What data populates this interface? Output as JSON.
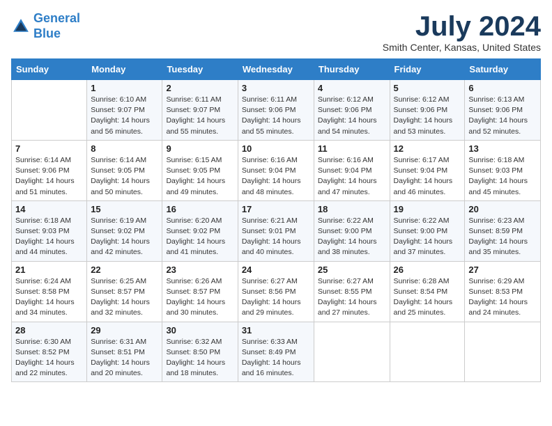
{
  "header": {
    "logo_line1": "General",
    "logo_line2": "Blue",
    "month": "July 2024",
    "location": "Smith Center, Kansas, United States"
  },
  "days_of_week": [
    "Sunday",
    "Monday",
    "Tuesday",
    "Wednesday",
    "Thursday",
    "Friday",
    "Saturday"
  ],
  "weeks": [
    [
      {
        "day": "",
        "sunrise": "",
        "sunset": "",
        "daylight": ""
      },
      {
        "day": "1",
        "sunrise": "Sunrise: 6:10 AM",
        "sunset": "Sunset: 9:07 PM",
        "daylight": "Daylight: 14 hours and 56 minutes."
      },
      {
        "day": "2",
        "sunrise": "Sunrise: 6:11 AM",
        "sunset": "Sunset: 9:07 PM",
        "daylight": "Daylight: 14 hours and 55 minutes."
      },
      {
        "day": "3",
        "sunrise": "Sunrise: 6:11 AM",
        "sunset": "Sunset: 9:06 PM",
        "daylight": "Daylight: 14 hours and 55 minutes."
      },
      {
        "day": "4",
        "sunrise": "Sunrise: 6:12 AM",
        "sunset": "Sunset: 9:06 PM",
        "daylight": "Daylight: 14 hours and 54 minutes."
      },
      {
        "day": "5",
        "sunrise": "Sunrise: 6:12 AM",
        "sunset": "Sunset: 9:06 PM",
        "daylight": "Daylight: 14 hours and 53 minutes."
      },
      {
        "day": "6",
        "sunrise": "Sunrise: 6:13 AM",
        "sunset": "Sunset: 9:06 PM",
        "daylight": "Daylight: 14 hours and 52 minutes."
      }
    ],
    [
      {
        "day": "7",
        "sunrise": "Sunrise: 6:14 AM",
        "sunset": "Sunset: 9:06 PM",
        "daylight": "Daylight: 14 hours and 51 minutes."
      },
      {
        "day": "8",
        "sunrise": "Sunrise: 6:14 AM",
        "sunset": "Sunset: 9:05 PM",
        "daylight": "Daylight: 14 hours and 50 minutes."
      },
      {
        "day": "9",
        "sunrise": "Sunrise: 6:15 AM",
        "sunset": "Sunset: 9:05 PM",
        "daylight": "Daylight: 14 hours and 49 minutes."
      },
      {
        "day": "10",
        "sunrise": "Sunrise: 6:16 AM",
        "sunset": "Sunset: 9:04 PM",
        "daylight": "Daylight: 14 hours and 48 minutes."
      },
      {
        "day": "11",
        "sunrise": "Sunrise: 6:16 AM",
        "sunset": "Sunset: 9:04 PM",
        "daylight": "Daylight: 14 hours and 47 minutes."
      },
      {
        "day": "12",
        "sunrise": "Sunrise: 6:17 AM",
        "sunset": "Sunset: 9:04 PM",
        "daylight": "Daylight: 14 hours and 46 minutes."
      },
      {
        "day": "13",
        "sunrise": "Sunrise: 6:18 AM",
        "sunset": "Sunset: 9:03 PM",
        "daylight": "Daylight: 14 hours and 45 minutes."
      }
    ],
    [
      {
        "day": "14",
        "sunrise": "Sunrise: 6:18 AM",
        "sunset": "Sunset: 9:03 PM",
        "daylight": "Daylight: 14 hours and 44 minutes."
      },
      {
        "day": "15",
        "sunrise": "Sunrise: 6:19 AM",
        "sunset": "Sunset: 9:02 PM",
        "daylight": "Daylight: 14 hours and 42 minutes."
      },
      {
        "day": "16",
        "sunrise": "Sunrise: 6:20 AM",
        "sunset": "Sunset: 9:02 PM",
        "daylight": "Daylight: 14 hours and 41 minutes."
      },
      {
        "day": "17",
        "sunrise": "Sunrise: 6:21 AM",
        "sunset": "Sunset: 9:01 PM",
        "daylight": "Daylight: 14 hours and 40 minutes."
      },
      {
        "day": "18",
        "sunrise": "Sunrise: 6:22 AM",
        "sunset": "Sunset: 9:00 PM",
        "daylight": "Daylight: 14 hours and 38 minutes."
      },
      {
        "day": "19",
        "sunrise": "Sunrise: 6:22 AM",
        "sunset": "Sunset: 9:00 PM",
        "daylight": "Daylight: 14 hours and 37 minutes."
      },
      {
        "day": "20",
        "sunrise": "Sunrise: 6:23 AM",
        "sunset": "Sunset: 8:59 PM",
        "daylight": "Daylight: 14 hours and 35 minutes."
      }
    ],
    [
      {
        "day": "21",
        "sunrise": "Sunrise: 6:24 AM",
        "sunset": "Sunset: 8:58 PM",
        "daylight": "Daylight: 14 hours and 34 minutes."
      },
      {
        "day": "22",
        "sunrise": "Sunrise: 6:25 AM",
        "sunset": "Sunset: 8:57 PM",
        "daylight": "Daylight: 14 hours and 32 minutes."
      },
      {
        "day": "23",
        "sunrise": "Sunrise: 6:26 AM",
        "sunset": "Sunset: 8:57 PM",
        "daylight": "Daylight: 14 hours and 30 minutes."
      },
      {
        "day": "24",
        "sunrise": "Sunrise: 6:27 AM",
        "sunset": "Sunset: 8:56 PM",
        "daylight": "Daylight: 14 hours and 29 minutes."
      },
      {
        "day": "25",
        "sunrise": "Sunrise: 6:27 AM",
        "sunset": "Sunset: 8:55 PM",
        "daylight": "Daylight: 14 hours and 27 minutes."
      },
      {
        "day": "26",
        "sunrise": "Sunrise: 6:28 AM",
        "sunset": "Sunset: 8:54 PM",
        "daylight": "Daylight: 14 hours and 25 minutes."
      },
      {
        "day": "27",
        "sunrise": "Sunrise: 6:29 AM",
        "sunset": "Sunset: 8:53 PM",
        "daylight": "Daylight: 14 hours and 24 minutes."
      }
    ],
    [
      {
        "day": "28",
        "sunrise": "Sunrise: 6:30 AM",
        "sunset": "Sunset: 8:52 PM",
        "daylight": "Daylight: 14 hours and 22 minutes."
      },
      {
        "day": "29",
        "sunrise": "Sunrise: 6:31 AM",
        "sunset": "Sunset: 8:51 PM",
        "daylight": "Daylight: 14 hours and 20 minutes."
      },
      {
        "day": "30",
        "sunrise": "Sunrise: 6:32 AM",
        "sunset": "Sunset: 8:50 PM",
        "daylight": "Daylight: 14 hours and 18 minutes."
      },
      {
        "day": "31",
        "sunrise": "Sunrise: 6:33 AM",
        "sunset": "Sunset: 8:49 PM",
        "daylight": "Daylight: 14 hours and 16 minutes."
      },
      {
        "day": "",
        "sunrise": "",
        "sunset": "",
        "daylight": ""
      },
      {
        "day": "",
        "sunrise": "",
        "sunset": "",
        "daylight": ""
      },
      {
        "day": "",
        "sunrise": "",
        "sunset": "",
        "daylight": ""
      }
    ]
  ]
}
